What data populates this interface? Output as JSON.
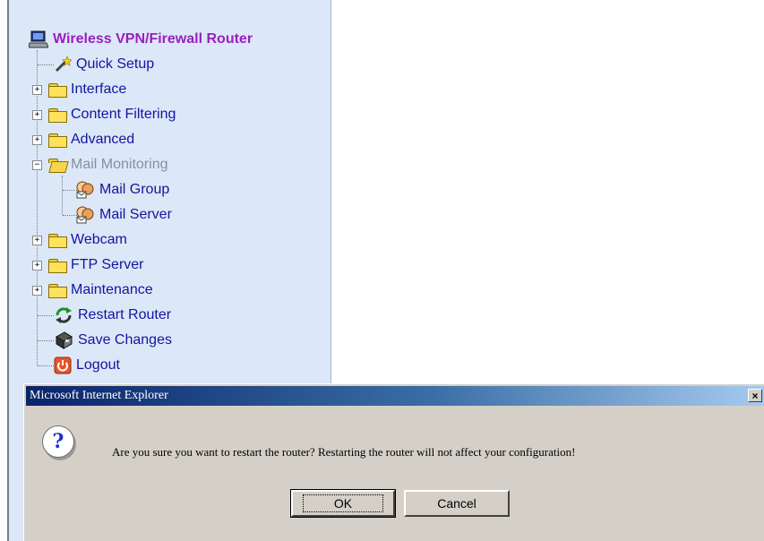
{
  "tree": {
    "root": {
      "label": "Wireless VPN/Firewall Router",
      "icon": "computer-icon"
    },
    "items": [
      {
        "label": "Quick Setup",
        "icon": "wand-icon"
      },
      {
        "label": "Interface",
        "icon": "folder-icon"
      },
      {
        "label": "Content Filtering",
        "icon": "folder-icon"
      },
      {
        "label": "Advanced",
        "icon": "folder-icon"
      },
      {
        "label": "Mail Monitoring",
        "icon": "folder-open-icon"
      },
      {
        "label": "Mail Group",
        "icon": "mail-user-icon"
      },
      {
        "label": "Mail Server",
        "icon": "mail-user-icon"
      },
      {
        "label": "Webcam",
        "icon": "folder-icon"
      },
      {
        "label": "FTP Server",
        "icon": "folder-icon"
      },
      {
        "label": "Maintenance",
        "icon": "folder-icon"
      },
      {
        "label": "Restart Router",
        "icon": "restart-icon"
      },
      {
        "label": "Save Changes",
        "icon": "save-icon"
      },
      {
        "label": "Logout",
        "icon": "power-icon"
      }
    ]
  },
  "dialog": {
    "title": "Microsoft Internet Explorer",
    "close_label": "×",
    "icon": "question-icon",
    "icon_glyph": "?",
    "message": "Are you sure you want to restart the router? Restarting the router will not affect your configuration!",
    "ok_label": "OK",
    "cancel_label": "Cancel"
  },
  "expander_symbols": {
    "collapsed": "+",
    "expanded": "−"
  },
  "colors": {
    "link": "#1414a0",
    "root_title": "#9a1fc0",
    "nav_bg": "#dce8f8",
    "dialog_bg": "#d4d0c8",
    "titlebar": "#0a246a"
  }
}
